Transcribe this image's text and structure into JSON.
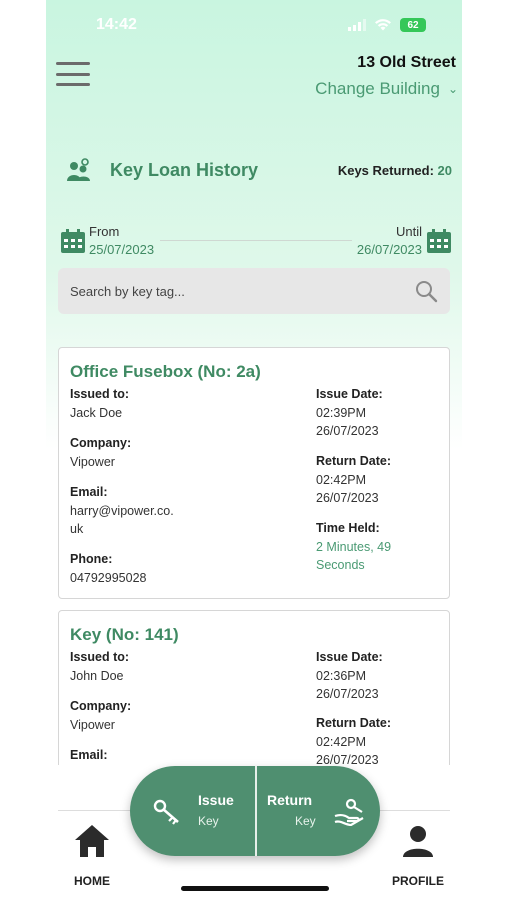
{
  "status_bar": {
    "time": "14:42",
    "battery": "62"
  },
  "header": {
    "building_name": "13 Old Street",
    "change_building": "Change Building"
  },
  "page": {
    "title": "Key Loan History",
    "keys_returned_label": "Keys Returned:",
    "keys_returned_count": "20"
  },
  "date_range": {
    "from_label": "From",
    "from_value": "25/07/2023",
    "until_label": "Until",
    "until_value": "26/07/2023"
  },
  "search": {
    "placeholder": "Search by key tag..."
  },
  "loans": [
    {
      "title": "Office Fusebox (No: 2a)",
      "issued_to_label": "Issued to:",
      "issued_to": "Jack Doe",
      "company_label": "Company:",
      "company": "Vipower",
      "email_label": "Email:",
      "email_line1": "harry@vipower.co.",
      "email_line2": "uk",
      "phone_label": "Phone:",
      "phone": "04792995028",
      "issue_date_label": "Issue Date:",
      "issue_time": "02:39PM",
      "issue_date": "26/07/2023",
      "return_date_label": "Return Date:",
      "return_time": "02:42PM",
      "return_date": "26/07/2023",
      "time_held_label": "Time Held:",
      "time_held_line1": "2 Minutes, 49",
      "time_held_line2": "Seconds"
    },
    {
      "title": "Key (No: 141)",
      "issued_to_label": "Issued to:",
      "issued_to": "John Doe",
      "company_label": "Company:",
      "company": "Vipower",
      "email_label": "Email:",
      "issue_date_label": "Issue Date:",
      "issue_time": "02:36PM",
      "issue_date": "26/07/2023",
      "return_date_label": "Return Date:",
      "return_time": "02:42PM",
      "return_date": "26/07/2023"
    }
  ],
  "fab": {
    "issue_label": "Issue",
    "issue_sub": "Key",
    "return_label": "Return",
    "return_sub": "Key"
  },
  "nav": {
    "home_label": "HOME",
    "profile_label": "PROFILE"
  },
  "colors": {
    "accent": "#3f8a63",
    "fab": "#4f8f70",
    "battery": "#35c759"
  },
  "icons": [
    "menu-icon",
    "chevron-down-icon",
    "people-key-icon",
    "calendar-icon",
    "search-icon",
    "key-issue-icon",
    "key-return-icon",
    "home-icon",
    "profile-icon"
  ]
}
